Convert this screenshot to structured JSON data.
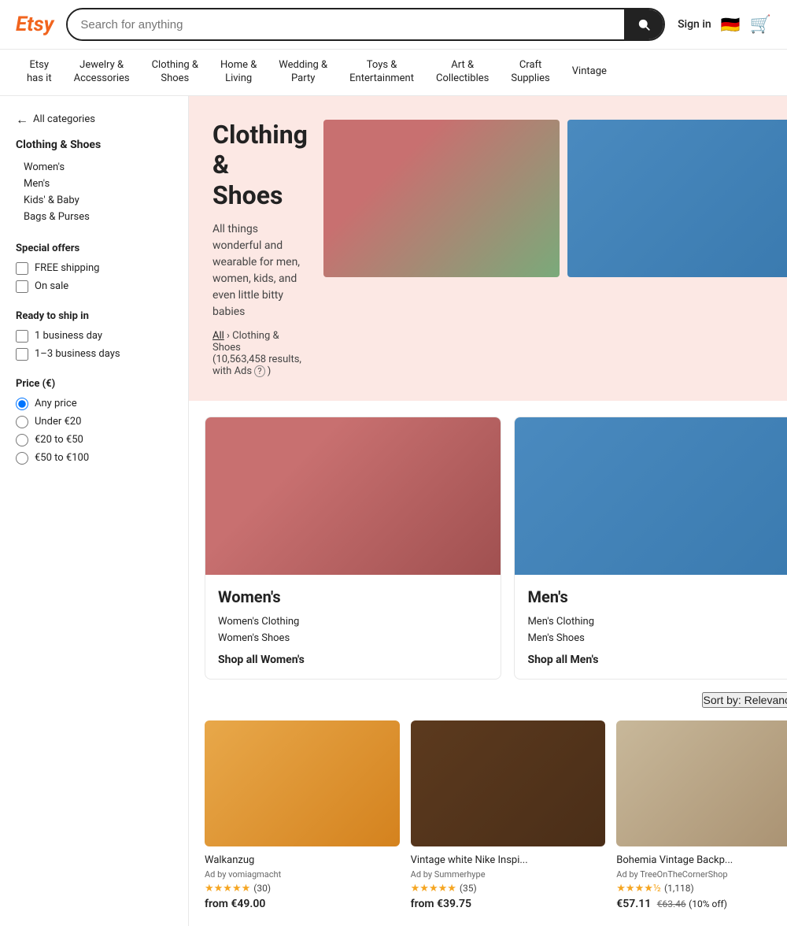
{
  "header": {
    "logo": "Etsy",
    "search_placeholder": "Search for anything",
    "sign_in_label": "Sign in",
    "flag_emoji": "🇩🇪",
    "cart_emoji": "🛒"
  },
  "nav": {
    "items": [
      {
        "id": "etsy-has-it",
        "label": "Etsy\nhas it"
      },
      {
        "id": "jewelry",
        "label": "Jewelry &\nAccessories"
      },
      {
        "id": "clothing",
        "label": "Clothing &\nShoes"
      },
      {
        "id": "home-living",
        "label": "Home &\nLiving"
      },
      {
        "id": "wedding",
        "label": "Wedding &\nParty"
      },
      {
        "id": "toys",
        "label": "Toys &\nEntertainment"
      },
      {
        "id": "art",
        "label": "Art &\nCollectibles"
      },
      {
        "id": "craft",
        "label": "Craft\nSupplies"
      },
      {
        "id": "vintage",
        "label": "Vintage"
      }
    ]
  },
  "hero": {
    "title": "Clothing &\nShoes",
    "description": "All things wonderful and wearable for men, women, kids, and even little bitty babies",
    "breadcrumb_all": "All",
    "breadcrumb_section": "Clothing & Shoes",
    "results_text": "(10,563,458 results, with Ads",
    "results_info": "?"
  },
  "sidebar": {
    "back_label": "All categories",
    "category_title": "Clothing & Shoes",
    "sub_items": [
      {
        "id": "womens",
        "label": "Women's"
      },
      {
        "id": "mens",
        "label": "Men's"
      },
      {
        "id": "kids",
        "label": "Kids' & Baby"
      },
      {
        "id": "bags",
        "label": "Bags & Purses"
      }
    ],
    "special_offers_title": "Special offers",
    "special_offers": [
      {
        "id": "free-shipping",
        "label": "FREE shipping"
      },
      {
        "id": "on-sale",
        "label": "On sale"
      }
    ],
    "ready_to_ship_title": "Ready to ship in",
    "ready_to_ship": [
      {
        "id": "1-day",
        "label": "1 business day"
      },
      {
        "id": "1-3-days",
        "label": "1–3 business days"
      }
    ],
    "price_title": "Price (€)",
    "price_options": [
      {
        "id": "any",
        "label": "Any price",
        "checked": true
      },
      {
        "id": "under20",
        "label": "Under €20",
        "checked": false
      },
      {
        "id": "20-50",
        "label": "€20 to €50",
        "checked": false
      },
      {
        "id": "50-100",
        "label": "€50 to €100",
        "checked": false
      }
    ]
  },
  "category_cards": [
    {
      "id": "womens-card",
      "title": "Women's",
      "links": [
        "Women's Clothing",
        "Women's Shoes"
      ],
      "shop_all": "Shop all Women's"
    },
    {
      "id": "mens-card",
      "title": "Men's",
      "links": [
        "Men's Clothing",
        "Men's Shoes"
      ],
      "shop_all": "Shop all Men's"
    }
  ],
  "sort": {
    "label": "Sort by: Relevancy",
    "arrow": "▼"
  },
  "products": [
    {
      "id": "product-1",
      "title": "Walkanzug",
      "ad_by": "Ad by vomiagmacht",
      "stars": "★★★★★",
      "rating": "4.9",
      "reviews": "(30)",
      "price": "from €49.00",
      "old_price": "",
      "discount": "",
      "img_class": "product-img-1"
    },
    {
      "id": "product-2",
      "title": "Vintage white Nike Inspi...",
      "ad_by": "Ad by Summerhype",
      "stars": "★★★★★",
      "rating": "5.0",
      "reviews": "(35)",
      "price": "from €39.75",
      "old_price": "",
      "discount": "",
      "img_class": "product-img-2"
    },
    {
      "id": "product-3",
      "title": "Bohemia Vintage Backp...",
      "ad_by": "Ad by TreeOnTheCornerShop",
      "stars": "★★★★½",
      "rating": "4.5",
      "reviews": "(1,118)",
      "price": "€57.11",
      "old_price": "€63.46",
      "discount": "(10% off)",
      "img_class": "product-img-3"
    }
  ]
}
